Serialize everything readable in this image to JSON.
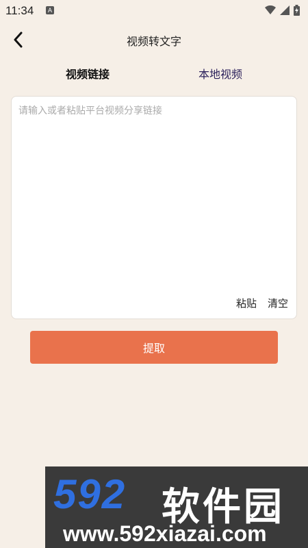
{
  "status_bar": {
    "time": "11:34",
    "notif_icon": "A"
  },
  "header": {
    "title": "视频转文字"
  },
  "tabs": [
    {
      "label": "视频链接",
      "active": true
    },
    {
      "label": "本地视频",
      "active": false
    }
  ],
  "input": {
    "placeholder": "请输入或者粘贴平台视频分享链接",
    "value": ""
  },
  "card_actions": {
    "paste": "粘贴",
    "clear": "清空"
  },
  "extract_button": {
    "label": "提取"
  },
  "watermark": {
    "brand": "592",
    "brand_cn": "软件园",
    "url": "www.592xiazai.com"
  },
  "colors": {
    "background": "#f6efe7",
    "accent": "#e9724c",
    "tab_inactive": "#2a1f5a"
  }
}
